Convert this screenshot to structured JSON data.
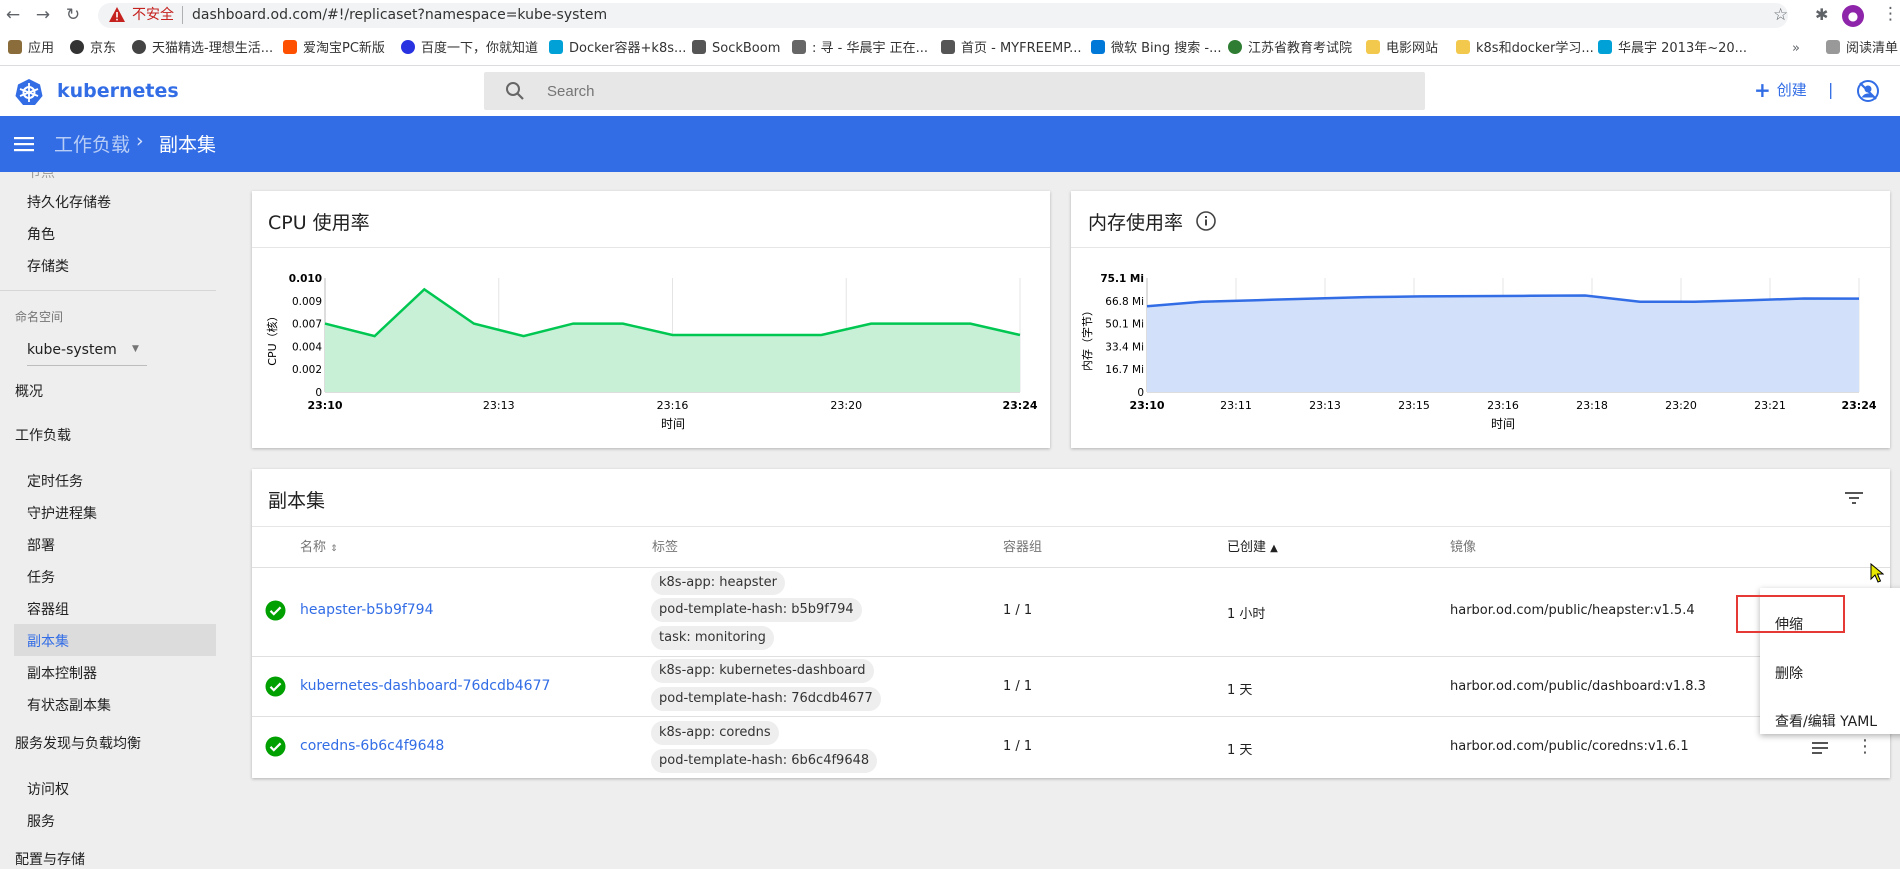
{
  "browser": {
    "not_secure": "不安全",
    "url": "dashboard.od.com/#!/replicaset?namespace=kube-system",
    "bookmarks": [
      "应用",
      "京东",
      "天猫精选-理想生活...",
      "爱淘宝PC新版",
      "百度一下，你就知道",
      "Docker容器+k8s...",
      "SockBoom",
      ": 寻 - 华晨宇 正在...",
      "首页 - MYFREEMP...",
      "微软 Bing 搜索 -...",
      "江苏省教育考试院",
      "电影网站",
      "k8s和docker学习...",
      "华晨宇 2013年~20..."
    ],
    "reading_list": "阅读清单"
  },
  "header": {
    "brand": "kubernetes",
    "search_placeholder": "Search",
    "create_label": "创建"
  },
  "toolbar": {
    "breadcrumb_parent": "工作负载",
    "breadcrumb_current": "副本集"
  },
  "sidebar": {
    "top_items": [
      "持久化存储卷",
      "角色",
      "存储类"
    ],
    "namespace_label": "命名空间",
    "namespace_value": "kube-system",
    "overview": "概况",
    "workloads": "工作负载",
    "workload_items": [
      "定时任务",
      "守护进程集",
      "部署",
      "任务",
      "容器组",
      "副本集",
      "副本控制器",
      "有状态副本集"
    ],
    "discovery": "服务发现与负载均衡",
    "discovery_items": [
      "访问权",
      "服务"
    ],
    "config": "配置与存储"
  },
  "cpu_card": {
    "title": "CPU 使用率"
  },
  "mem_card": {
    "title": "内存使用率"
  },
  "chart_data": [
    {
      "type": "area",
      "title": "CPU 使用率",
      "xlabel": "时间",
      "ylabel": "CPU（核）",
      "x_ticks": [
        "23:10",
        "23:13",
        "23:16",
        "23:20",
        "23:24"
      ],
      "y_ticks": [
        "0",
        "0.002",
        "0.004",
        "0.007",
        "0.009",
        "0.010"
      ],
      "ylim": [
        0,
        0.01
      ],
      "series": [
        {
          "values": [
            0.006,
            0.0049,
            0.009,
            0.006,
            0.0049,
            0.006,
            0.006,
            0.005,
            0.005,
            0.005,
            0.005,
            0.006,
            0.006,
            0.006,
            0.005
          ]
        }
      ],
      "color": "#00c752"
    },
    {
      "type": "area",
      "title": "内存使用率",
      "xlabel": "时间",
      "ylabel": "内存（字节）",
      "x_ticks": [
        "23:10",
        "23:11",
        "23:13",
        "23:15",
        "23:16",
        "23:18",
        "23:20",
        "23:21",
        "23:24"
      ],
      "y_ticks": [
        "0",
        "16.7 Mi",
        "33.4 Mi",
        "50.1 Mi",
        "66.8 Mi",
        "75.1 Mi"
      ],
      "ylim": [
        0,
        75.1
      ],
      "series": [
        {
          "values": [
            56.5,
            59.5,
            60.5,
            61.5,
            62.5,
            63,
            63.2,
            63.4,
            63.6,
            59.5,
            59.5,
            60.5,
            61.6,
            61.5
          ]
        }
      ],
      "color": "#326de6"
    }
  ],
  "replica_table": {
    "title": "副本集",
    "columns": [
      "名称",
      "标签",
      "容器组",
      "已创建",
      "镜像"
    ],
    "rows": [
      {
        "name": "heapster-b5b9f794",
        "labels": [
          "k8s-app: heapster",
          "pod-template-hash: b5b9f794",
          "task: monitoring"
        ],
        "pods": "1 / 1",
        "created": "1 小时",
        "image": "harbor.od.com/public/heapster:v1.5.4"
      },
      {
        "name": "kubernetes-dashboard-76dcdb4677",
        "labels": [
          "k8s-app: kubernetes-dashboard",
          "pod-template-hash: 76dcdb4677"
        ],
        "pods": "1 / 1",
        "created": "1 天",
        "image": "harbor.od.com/public/dashboard:v1.8.3"
      },
      {
        "name": "coredns-6b6c4f9648",
        "labels": [
          "k8s-app: coredns",
          "pod-template-hash: 6b6c4f9648"
        ],
        "pods": "1 / 1",
        "created": "1 天",
        "image": "harbor.od.com/public/coredns:v1.6.1"
      }
    ]
  },
  "context_menu": {
    "items": [
      "伸缩",
      "删除",
      "查看/编辑 YAML"
    ]
  },
  "colors": {
    "primary": "#326de6",
    "success": "#00a000",
    "cpu": "#00c752",
    "highlight": "#e53935"
  }
}
